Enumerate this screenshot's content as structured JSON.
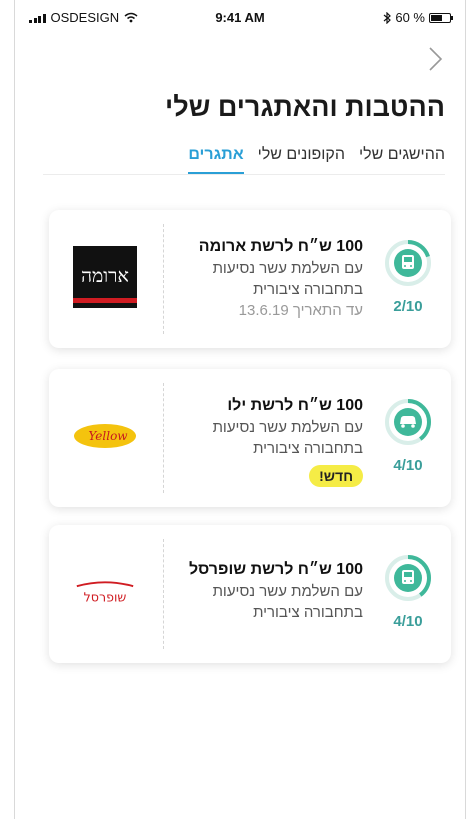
{
  "status_bar": {
    "carrier": "OSDESIGN",
    "time": "9:41 AM",
    "battery_text": "60 %",
    "battery_level": 0.6
  },
  "header": {
    "title": "ההטבות והאתגרים שלי"
  },
  "tabs": [
    {
      "label": "אתגרים",
      "active": true
    },
    {
      "label": "הקופונים שלי",
      "active": false
    },
    {
      "label": "ההישגים שלי",
      "active": false
    }
  ],
  "cards": [
    {
      "title": "100 ש״ח לרשת ארומה",
      "line1": "עם השלמת עשר נסיעות",
      "line2": "בתחבורה ציבורית",
      "extra": "עד התאריך 13.6.19",
      "badge": "",
      "progress_text": "2/10",
      "progress": 0.2,
      "icon": "bus-icon",
      "brand": "ארומה"
    },
    {
      "title": "100 ש״ח לרשת ילו",
      "line1": "עם השלמת עשר נסיעות",
      "line2": "בתחבורה ציבורית",
      "extra": "",
      "badge": "חדש!",
      "progress_text": "4/10",
      "progress": 0.4,
      "icon": "car-icon",
      "brand": "Yellow"
    },
    {
      "title": "100 ש״ח לרשת שופרסל",
      "line1": "עם השלמת עשר נסיעות",
      "line2": "בתחבורה ציבורית",
      "extra": "",
      "badge": "",
      "progress_text": "4/10",
      "progress": 0.4,
      "icon": "bus-icon",
      "brand": "שופרסל"
    }
  ],
  "colors": {
    "accent": "#2a9fd6",
    "progress": "#3fb89a",
    "progress_track": "#d9eee9",
    "badge": "#f5ec46"
  }
}
